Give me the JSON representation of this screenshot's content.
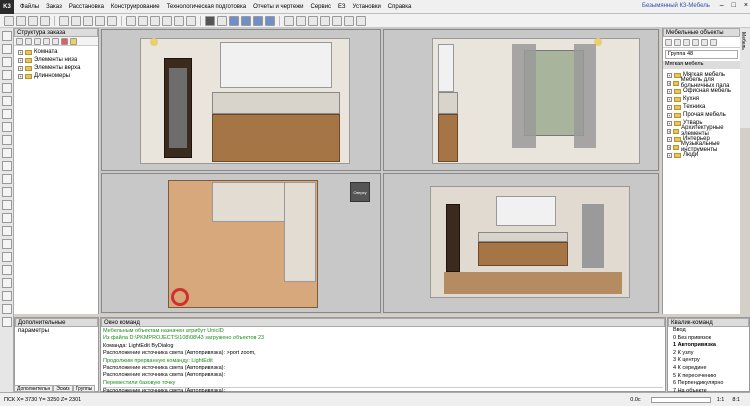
{
  "app": {
    "logo_text": "K3",
    "title": "Безымянный К3-Мебель",
    "window_controls": [
      "–",
      "□",
      "×"
    ]
  },
  "menu": [
    "Файлы",
    "Заказ",
    "Расстановка",
    "Конструирование",
    "Технологическая подготовка",
    "Отчеты и чертежи",
    "Сервис",
    "ЕЗ",
    "Установки",
    "Справка"
  ],
  "left_panel": {
    "title": "Структура заказа",
    "items": [
      {
        "label": "Комната"
      },
      {
        "label": "Элементы низа"
      },
      {
        "label": "Элементы верха"
      },
      {
        "label": "Длинномеры"
      }
    ]
  },
  "right_panel": {
    "title": "Мебельные объекты",
    "dropdown": "Группа 48",
    "category_header": "Мягкая мебель",
    "items": [
      {
        "label": "Мягкая мебель"
      },
      {
        "label": "Мебель для больничных пала"
      },
      {
        "label": "Офисная мебель"
      },
      {
        "label": "Кухня"
      },
      {
        "label": "Техника"
      },
      {
        "label": "Прочая мебель"
      },
      {
        "label": "Утварь"
      },
      {
        "label": "Архитектурные элементы"
      },
      {
        "label": "Интерьер"
      },
      {
        "label": "Музыкальные инструменты"
      },
      {
        "label": "Люди"
      }
    ],
    "side_tab": "Мебель"
  },
  "bottom_left": {
    "title": "Дополнительные параметры",
    "tabs": [
      "Дополнительн",
      "Эскиз",
      "Группы"
    ]
  },
  "command_window": {
    "title": "Окно команд",
    "lines": [
      {
        "text": "Мебельным объектам назначен атрибут UnicID",
        "color": "#1a8f1a"
      },
      {
        "text": "Из файла D:\\PKMPROJECTS\\108\\08\\43 загружено объектов 23",
        "color": "#1a8f1a"
      },
      {
        "text": "Команда:  LightEdit ByDialog",
        "color": "#000000"
      },
      {
        "text": "Расположение источника света (Автопривязка): >port zoom,",
        "color": "#000000"
      },
      {
        "text": "Продолжим прерванную команду: LightEdit",
        "color": "#1a8f1a"
      },
      {
        "text": "Расположение источника света (Автопривязка):",
        "color": "#000000"
      },
      {
        "text": "Расположение источника света (Автопривязка):",
        "color": "#000000"
      },
      {
        "text": "Переместили базовую точку",
        "color": "#1a8f1a"
      },
      {
        "text": "Расположение источника света (Автопривязка):",
        "color": "#000000"
      },
      {
        "text": "Расположение источника света (Автопривязка):",
        "color": "#000000"
      }
    ]
  },
  "snap_panel": {
    "title": "Ввод",
    "header": "Квалик-команд",
    "items": [
      "Ввод",
      "0 Без привязок",
      "1 Автопривязка",
      "2 К узлу",
      "3 К центру",
      "4 К середине",
      "5 К пересечению",
      "6 Перпендикулярно",
      "7 На объекте"
    ]
  },
  "statusbar": {
    "left": "ПСК X= 3730   Y= 3250   Z= 2301",
    "zoom": "0.0c",
    "scale": "1:1",
    "ratio": "8:1"
  },
  "viewports": {
    "compass_label": "Сверху"
  }
}
